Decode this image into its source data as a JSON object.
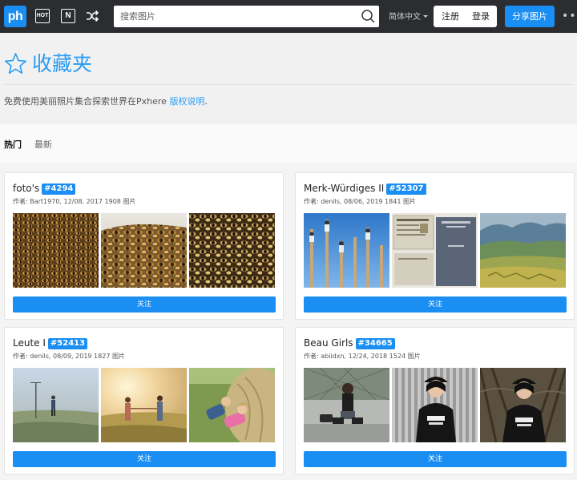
{
  "topbar": {
    "logo": "ph",
    "hot_icon_label": "HOT",
    "new_icon_label": "N",
    "search_placeholder": "搜索图片",
    "language": "简体中文",
    "register": "注册",
    "login": "登录",
    "share": "分享图片",
    "more": "•••"
  },
  "header": {
    "title": "收藏夹",
    "desc_text": "免费使用美丽照片集合探索世界在Pxhere ",
    "desc_link": "版权说明",
    "desc_end": "."
  },
  "tabs": {
    "hot": "热门",
    "latest": "最新"
  },
  "colors": {
    "accent": "#1a8ef2",
    "link": "#2a9cf2",
    "topbar": "#2b2d30"
  },
  "cards": [
    {
      "title": "foto's",
      "id": "#4294",
      "meta": "作者: Bart1970, 12/08, 2017 1908 图片",
      "thumbs": [
        "bees-swarm-photo",
        "bees-comb-photo",
        "bees-closeup-photo"
      ],
      "follow": "关注"
    },
    {
      "title": "Merk-Würdiges II",
      "id": "#52307",
      "meta": "作者: denils, 08/06, 2019 1841 图片",
      "thumbs": [
        "pole-climbers-photo",
        "postcards-photo",
        "landscape-painting-photo"
      ],
      "follow": "关注"
    },
    {
      "title": "Leute I",
      "id": "#52413",
      "meta": "作者: denils, 08/09, 2019 1827 图片",
      "thumbs": [
        "misty-field-walker-photo",
        "sunset-couple-field-photo",
        "children-hay-bale-photo"
      ],
      "follow": "关注"
    },
    {
      "title": "Beau Girls",
      "id": "#34665",
      "meta": "作者: abiidxn, 12/24, 2018 1524 图片",
      "thumbs": [
        "girl-sitting-street-photo",
        "girl-beanie-wall-photo",
        "girl-beanie-woods-photo"
      ],
      "follow": "关注"
    }
  ]
}
